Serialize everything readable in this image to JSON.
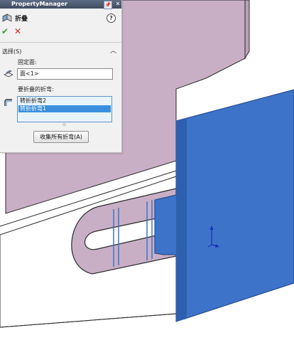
{
  "panel": {
    "title": "PropertyManager",
    "pin_glyph": "📌",
    "close_glyph": "✕",
    "feature_name": "折叠",
    "help_glyph": "?",
    "ok_glyph": "✔",
    "cancel_glyph": "✕",
    "section_title": "选择(S)",
    "section_chevron": "︿",
    "fixed_face_label": "固定面:",
    "fixed_face_value": "面<1>",
    "bends_label": "要折叠的折弯:",
    "bends": [
      "转折折弯2",
      "转折折弯1"
    ],
    "selected_bend": "转折折弯1",
    "grip_glyph": "⊙",
    "collect_button": "收集所有折弯(A)"
  },
  "icons": [
    "fold-feature-icon",
    "help-icon",
    "ok-icon",
    "cancel-icon",
    "face-select-icon",
    "bend-select-icon",
    "triad-icon"
  ],
  "colors": {
    "title_bar": "#4a566d",
    "panel_bg": "#f1f1f1",
    "selected_face": "#3d73c9",
    "part_wall": "#c8afc6",
    "list_highlight": "#3b8fde"
  }
}
